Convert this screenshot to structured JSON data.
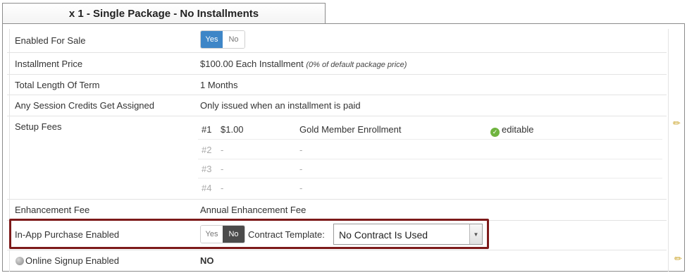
{
  "tab": {
    "title": "x 1 - Single Package - No Installments"
  },
  "rows": {
    "enabled_for_sale": {
      "label": "Enabled For Sale",
      "yes": "Yes",
      "no": "No",
      "selected": "Yes"
    },
    "installment_price": {
      "label": "Installment Price",
      "value": "$100.00 Each Installment",
      "note": "(0% of default package price)"
    },
    "total_length": {
      "label": "Total Length Of Term",
      "value": "1 Months"
    },
    "session_credits": {
      "label": "Any Session Credits Get Assigned",
      "value": "Only issued when an installment is paid"
    },
    "setup_fees": {
      "label": "Setup Fees",
      "items": [
        {
          "num": "#1",
          "amount": "$1.00",
          "name": "Gold Member Enrollment",
          "status": "editable"
        },
        {
          "num": "#2",
          "amount": "-",
          "name": "-"
        },
        {
          "num": "#3",
          "amount": "-",
          "name": "-"
        },
        {
          "num": "#4",
          "amount": "-",
          "name": "-"
        }
      ]
    },
    "enhancement_fee": {
      "label": "Enhancement Fee",
      "value": "Annual Enhancement Fee"
    },
    "in_app_purchase": {
      "label": "In-App Purchase Enabled",
      "yes": "Yes",
      "no": "No",
      "selected": "No",
      "contract_label": "Contract Template:",
      "contract_value": "No Contract Is Used"
    },
    "online_signup": {
      "label": "Online Signup Enabled",
      "value": "NO"
    }
  },
  "colors": {
    "highlight": "#7d1a1a",
    "yes_active": "#3e86c7",
    "no_active": "#4b4b4b",
    "check": "#6fb43f"
  }
}
